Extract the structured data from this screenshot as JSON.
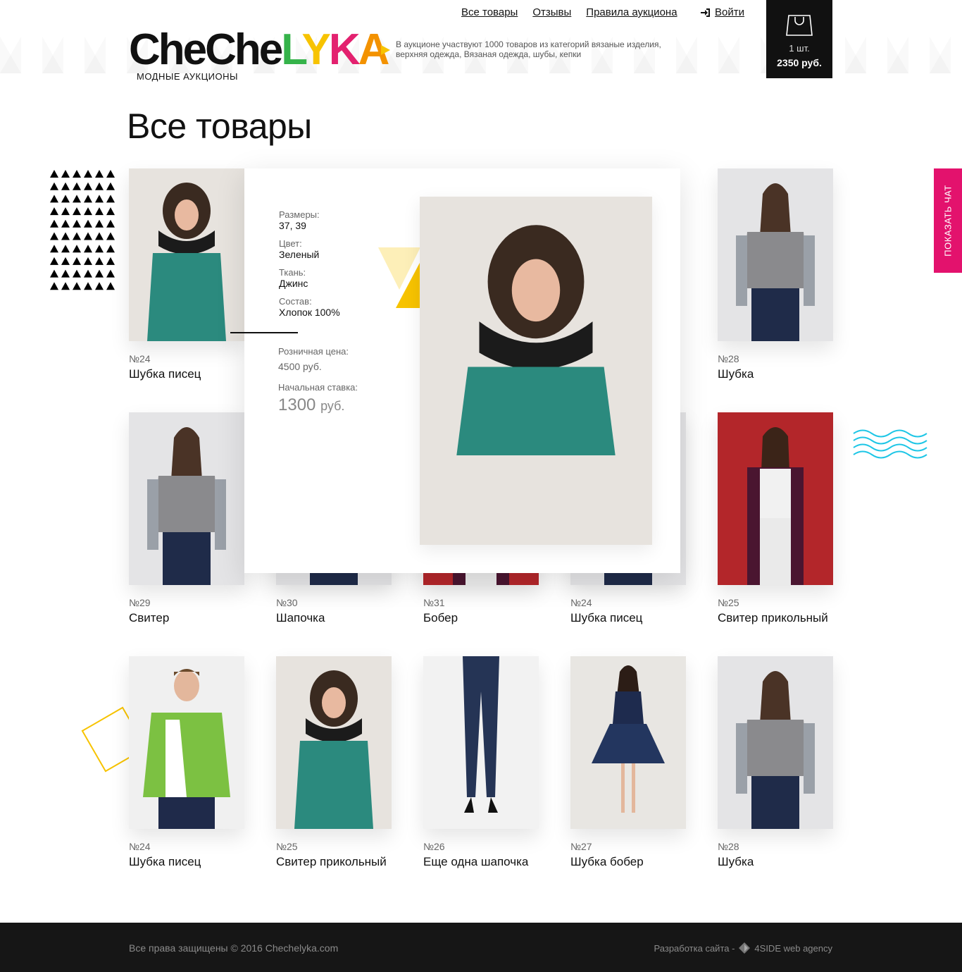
{
  "header": {
    "logo_main": "CheChe",
    "logo_l": "L",
    "logo_y": "Y",
    "logo_k": "K",
    "logo_a": "A",
    "logo_sub": "МОДНЫЕ АУКЦИОНЫ",
    "description": "В аукционе участвуют 1000 товаров из категорий вязаные изделия, верхняя одежда, Вязаная одежда, шубы, кепки",
    "nav": [
      "Все товары",
      "Отзывы",
      "Правила аукциона"
    ],
    "login": "Войти",
    "cart": {
      "qty": "1 шт.",
      "sum": "2350 руб."
    }
  },
  "page_title": "Все товары",
  "chat_tab": "ПОКАЗАТЬ ЧАТ",
  "colors": {
    "accent_pink": "#e3126d",
    "accent_yellow": "#f7c300",
    "accent_blue": "#1ec6e6",
    "footer_bg": "#161616"
  },
  "products": [
    {
      "num": "№24",
      "name": "Шубка писец",
      "img": "teal"
    },
    {
      "num": "",
      "name": "",
      "img": "hidden"
    },
    {
      "num": "",
      "name": "",
      "img": "hidden"
    },
    {
      "num": "",
      "name": "",
      "img": "hidden"
    },
    {
      "num": "№28",
      "name": "Шубка",
      "img": "grey"
    },
    {
      "num": "№29",
      "name": "Свитер",
      "img": "grey"
    },
    {
      "num": "№30",
      "name": "Шапочка",
      "img": "grey"
    },
    {
      "num": "№31",
      "name": "Бобер",
      "img": "red"
    },
    {
      "num": "№24",
      "name": "Шубка писец",
      "img": "grey"
    },
    {
      "num": "№25",
      "name": "Свитер прикольный",
      "img": "red"
    },
    {
      "num": "№24",
      "name": "Шубка писец",
      "img": "green"
    },
    {
      "num": "№25",
      "name": "Свитер прикольный",
      "img": "teal"
    },
    {
      "num": "№26",
      "name": "Еще одна шапочка",
      "img": "jeans"
    },
    {
      "num": "№27",
      "name": "Шубка бобер",
      "img": "dress"
    },
    {
      "num": "№28",
      "name": "Шубка",
      "img": "grey"
    }
  ],
  "popup": {
    "sizes_label": "Размеры:",
    "sizes": "37, 39",
    "color_label": "Цвет:",
    "color": "Зеленый",
    "fabric_label": "Ткань:",
    "fabric": "Джинс",
    "composition_label": "Состав:",
    "composition": "Хлопок 100%",
    "retail_label": "Розничная цена:",
    "retail": "4500 руб.",
    "bid_label": "Начальная ставка:",
    "bid": "1300",
    "bid_currency": "руб."
  },
  "footer": {
    "copyright": "Все права защищены © 2016 Chechelyka.com",
    "dev_label": "Разработка сайта -",
    "dev_agency": "4SIDE web agency"
  }
}
